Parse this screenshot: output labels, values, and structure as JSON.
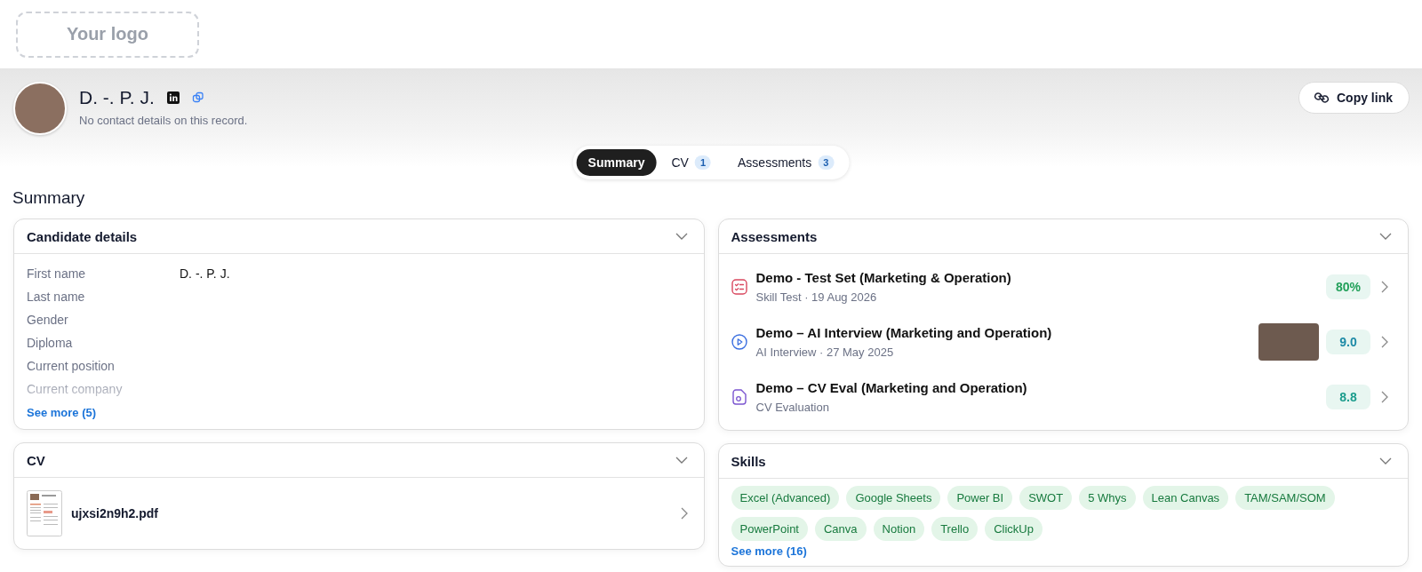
{
  "logo": {
    "text": "Your logo"
  },
  "profile": {
    "name": "D. -. P. J.",
    "linkedin": true,
    "subtitle": "No contact details on this record.",
    "copy_button": "Copy link"
  },
  "tabs": [
    {
      "label": "Summary",
      "selected": true
    },
    {
      "label": "CV",
      "count": "1",
      "selected": false
    },
    {
      "label": "Assessments",
      "count": "3",
      "selected": false
    }
  ],
  "heading": "Summary",
  "candidate_details": {
    "title": "Candidate details",
    "expanded": true,
    "fields": [
      {
        "label": "First name",
        "value": "D. -. P. J."
      },
      {
        "label": "Last name"
      },
      {
        "label": "Gender"
      },
      {
        "label": "Diploma"
      },
      {
        "label": "Current position"
      },
      {
        "label": "Current company"
      }
    ],
    "see_more": "See more (5)"
  },
  "cv": {
    "title": "CV",
    "expanded": true,
    "file": "ujxsi2n9h2.pdf"
  },
  "assessments": {
    "title": "Assessments",
    "expanded": true,
    "items": [
      {
        "kind": "skill_test",
        "title": "Demo - Test Set (Marketing & Operation)",
        "meta": "Skill Test · 19 Aug 2026",
        "video": false,
        "score": "80%",
        "color": "#22a05a"
      },
      {
        "kind": "ai_interview",
        "title": "Demo – AI Interview (Marketing and Operation)",
        "meta": "AI Interview · 27 May 2025",
        "video": true,
        "score": "9.0",
        "color": "#1d8aa6"
      },
      {
        "kind": "cv_eval",
        "title": "Demo – CV Eval (Marketing and Operation)",
        "meta": "CV Evaluation",
        "video": false,
        "score": "8.8",
        "color": "#1a9c8c"
      }
    ]
  },
  "skills": {
    "title": "Skills",
    "expanded": true,
    "items": [
      "Excel (Advanced)",
      "Google Sheets",
      "Power BI",
      "SWOT",
      "5 Whys",
      "Lean Canvas",
      "TAM/SAM/SOM",
      "PowerPoint",
      "Canva",
      "Notion",
      "Trello",
      "ClickUp"
    ],
    "see_more": "See more (16)"
  }
}
